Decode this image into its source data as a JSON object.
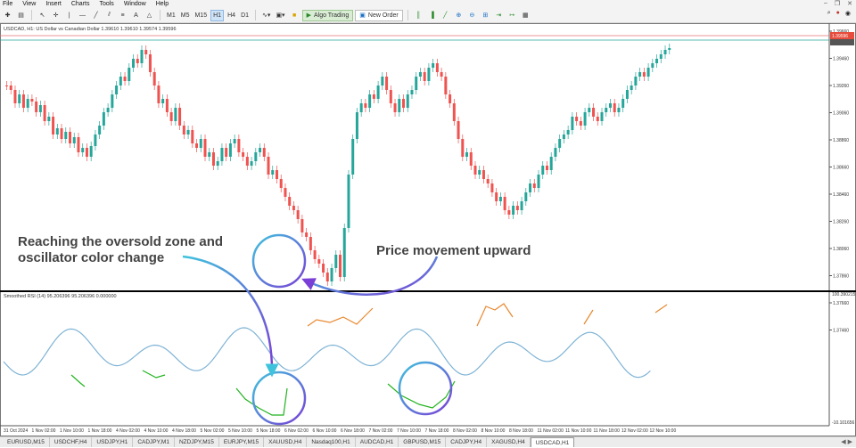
{
  "menu": [
    "File",
    "View",
    "Insert",
    "Charts",
    "Tools",
    "Window",
    "Help"
  ],
  "toolbar": {
    "timeframes": [
      "M1",
      "M5",
      "M15",
      "H1",
      "H4",
      "D1"
    ],
    "active_timeframe": "H1",
    "algo_trading": "Algo Trading",
    "new_order": "New Order"
  },
  "chart": {
    "header": "USDCAD, H1:  US Dollar vs Canadian Dollar  1.39610 1.39610 1.39574 1.39596",
    "price_labels": [
      "1.39660",
      "1.39460",
      "1.39260",
      "1.39060",
      "1.38860",
      "1.38660",
      "1.38460",
      "1.38260",
      "1.38060",
      "1.37860",
      "1.37660",
      "1.37460"
    ],
    "current_price": "1.39596",
    "indicator_header": "Smoothed RSI (14) 95.206396 95.206396 0.000000",
    "indicator_max": "100.390215",
    "indicator_min": "-10.101656",
    "time_labels": [
      "31 Oct 2024",
      "1 Nov 02:00",
      "1 Nov 10:00",
      "1 Nov 18:00",
      "4 Nov 02:00",
      "4 Nov 10:00",
      "4 Nov 18:00",
      "5 Nov 02:00",
      "5 Nov 10:00",
      "5 Nov 18:00",
      "6 Nov 02:00",
      "6 Nov 10:00",
      "6 Nov 18:00",
      "7 Nov 02:00",
      "7 Nov 10:00",
      "7 Nov 18:00",
      "8 Nov 02:00",
      "8 Nov 10:00",
      "8 Nov 18:00",
      "11 Nov 02:00",
      "11 Nov 10:00",
      "11 Nov 18:00",
      "12 Nov 02:00",
      "12 Nov 10:00"
    ]
  },
  "annotations": {
    "oversold": "Reaching the oversold zone and oscillator color change",
    "upward": "Price movement upward"
  },
  "tabs": [
    "EURUSD,M15",
    "USDCHF,H4",
    "USDJPY,H1",
    "CADJPY,M1",
    "NZDJPY,M15",
    "EURJPY,M15",
    "XAUUSD,H4",
    "Nasdaq100,H1",
    "AUDCAD,H1",
    "GBPUSD,M15",
    "CADJPY,H4",
    "XAGUSD,H4",
    "USDCAD,H1"
  ],
  "active_tab": "USDCAD,H1",
  "colors": {
    "bull": "#26a69a",
    "bear": "#ef5350",
    "rsi_mid": "#7fb3d5",
    "rsi_low": "#22b41e",
    "rsi_high": "#e8882f",
    "circle_start": "#3fc3dd",
    "circle_end": "#7a3fd6"
  }
}
